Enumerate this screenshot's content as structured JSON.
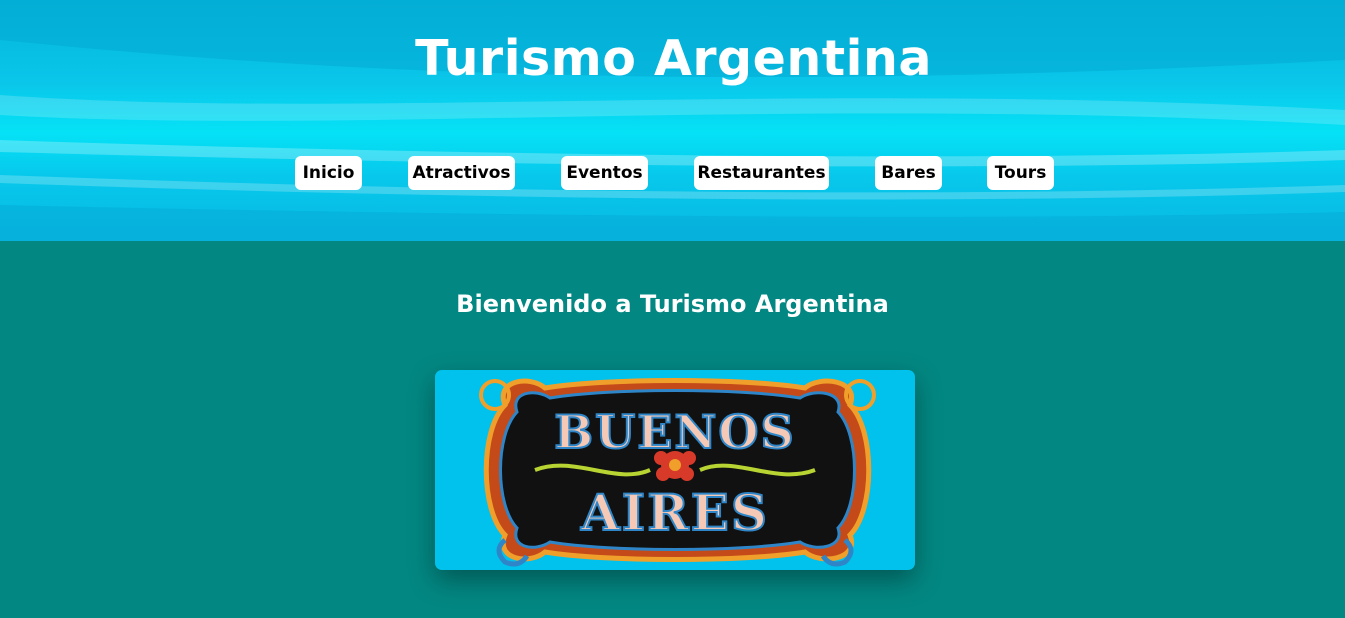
{
  "site": {
    "title": "Turismo Argentina"
  },
  "nav": {
    "items": [
      {
        "label": "Inicio"
      },
      {
        "label": "Atractivos"
      },
      {
        "label": "Eventos"
      },
      {
        "label": "Restaurantes"
      },
      {
        "label": "Bares"
      },
      {
        "label": "Tours"
      }
    ]
  },
  "main": {
    "welcome": "Bienvenido a Turismo Argentina",
    "hero": {
      "line1": "BUENOS",
      "line2": "AIRES"
    }
  },
  "colors": {
    "header_bg": "#0ac7ea",
    "page_bg": "#038782",
    "hero_bg": "#00c2ec",
    "nav_button_bg": "#ffffff",
    "title_text": "#ffffff"
  }
}
